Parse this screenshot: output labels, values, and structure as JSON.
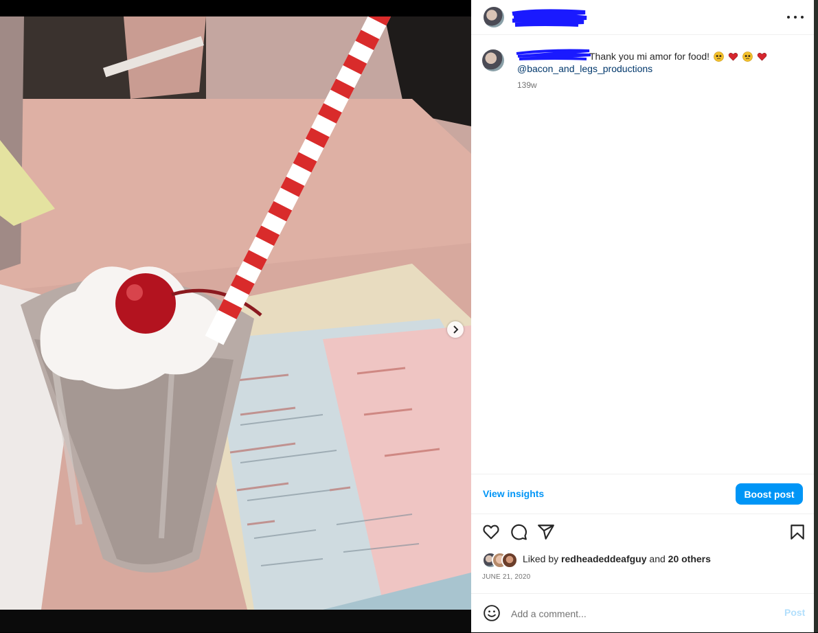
{
  "post": {
    "caption": "Thank you mi amor for food!",
    "mention": "@bacon_and_legs_productions",
    "time_ago": "139w",
    "date": "JUNE 21, 2020"
  },
  "header": {
    "more_icon": "more-horizontal-icon"
  },
  "insights": {
    "view_label": "View insights",
    "boost_label": "Boost post"
  },
  "actions": {
    "like_icon": "heart-icon",
    "comment_icon": "comment-icon",
    "share_icon": "send-icon",
    "save_icon": "bookmark-icon"
  },
  "likes": {
    "prefix": "Liked by ",
    "user": "redheadeddeafguy",
    "middle": " and ",
    "others": "20 others"
  },
  "comment": {
    "placeholder": "Add a comment...",
    "post_label": "Post"
  },
  "carousel": {
    "total": 2,
    "current": 1
  },
  "colors": {
    "accent": "#0095f6",
    "link": "#00376b",
    "heart_red": "#e0245e"
  }
}
